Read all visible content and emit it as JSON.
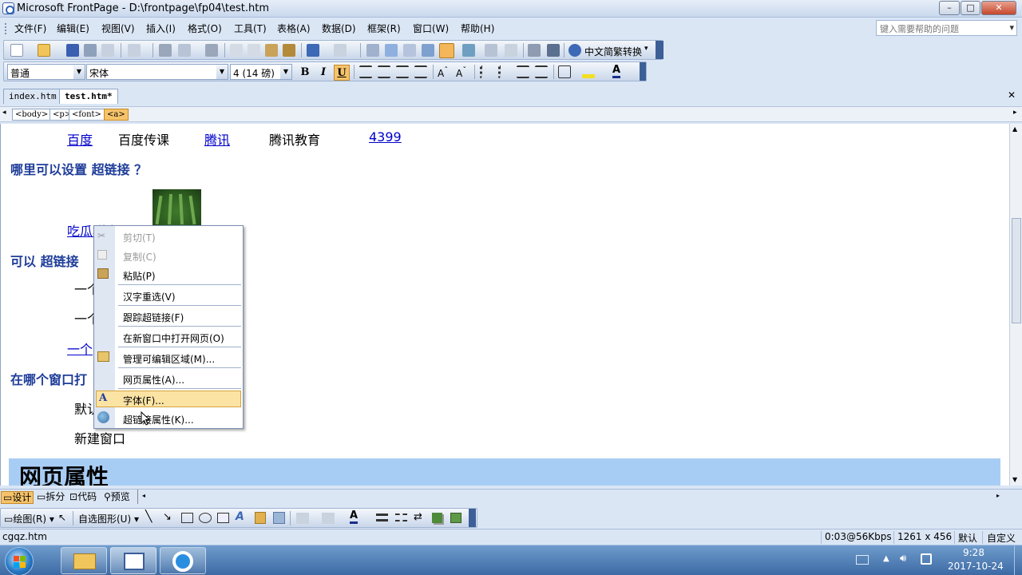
{
  "app": {
    "title": "Microsoft FrontPage - D:\\frontpage\\fp04\\test.htm",
    "window_buttons": {
      "minimize": "–",
      "maximize": "□",
      "close": "✕"
    }
  },
  "menu": [
    "文件(F)",
    "编辑(E)",
    "视图(V)",
    "插入(I)",
    "格式(O)",
    "工具(T)",
    "表格(A)",
    "数据(D)",
    "框架(R)",
    "窗口(W)",
    "帮助(H)"
  ],
  "help_placeholder": "键入需要帮助的问题",
  "toolbar": {
    "convert_label": "中文简繁转换"
  },
  "format_toolbar": {
    "style": "普通",
    "font": "宋体",
    "size": "4 (14 磅)",
    "bold": "B",
    "italic": "I",
    "underline": "U"
  },
  "tabs": [
    {
      "label": "index.htm",
      "active": false
    },
    {
      "label": "test.htm*",
      "active": true
    }
  ],
  "tab_close": "✕",
  "tag_path": [
    "<body>",
    "<p>",
    "<font>",
    "<a>"
  ],
  "document": {
    "links_row": {
      "link1": "百度",
      "text1": "百度传课",
      "link2": "腾讯",
      "text2": "腾讯教育",
      "link3": "4399"
    },
    "q1": "哪里可以设置 超链接 ？",
    "link_eat": "吃瓜群众",
    "q2_prefix": "可以  超链接",
    "bullet1": "一个",
    "bullet2": "一个",
    "bullet3": "一个",
    "q3": "在哪个窗口打",
    "default_text": "默认",
    "new_window": "新建窗口",
    "heading": "网页属性"
  },
  "context_menu": {
    "items": [
      {
        "label": "剪切(T)",
        "enabled": false,
        "icon": "cut-icon"
      },
      {
        "label": "复制(C)",
        "enabled": false,
        "icon": "copy-icon"
      },
      {
        "label": "粘贴(P)",
        "enabled": true,
        "icon": "paste-icon"
      },
      {
        "label": "汉字重选(V)",
        "enabled": true
      },
      {
        "label": "跟踪超链接(F)",
        "enabled": true
      },
      {
        "label": "在新窗口中打开网页(O)",
        "enabled": true
      },
      {
        "label": "管理可编辑区域(M)...",
        "enabled": true,
        "icon": "editable-region-icon"
      },
      {
        "label": "网页属性(A)...",
        "enabled": true
      },
      {
        "label": "字体(F)...",
        "enabled": true,
        "highlighted": true,
        "icon": "font-icon"
      },
      {
        "label": "超链接属性(K)...",
        "enabled": true,
        "icon": "hyperlink-icon"
      }
    ],
    "highlight_color": "#fbe3a4"
  },
  "view_tabs": [
    "设计",
    "拆分",
    "代码",
    "预览"
  ],
  "drawing_toolbar": {
    "draw": "绘图(R)",
    "autoshapes": "自选图形(U)"
  },
  "status": {
    "filename": "cgqz.htm",
    "speed": "0:03@56Kbps",
    "dims": "1261 x 456",
    "default": "默认",
    "custom": "自定义"
  },
  "taskbar": {
    "time": "9:28",
    "date": "2017-10-24"
  },
  "colors": {
    "link": "#0000cc",
    "heading_band": "#a8cdf5",
    "accent_bold": "#1f3d99"
  }
}
